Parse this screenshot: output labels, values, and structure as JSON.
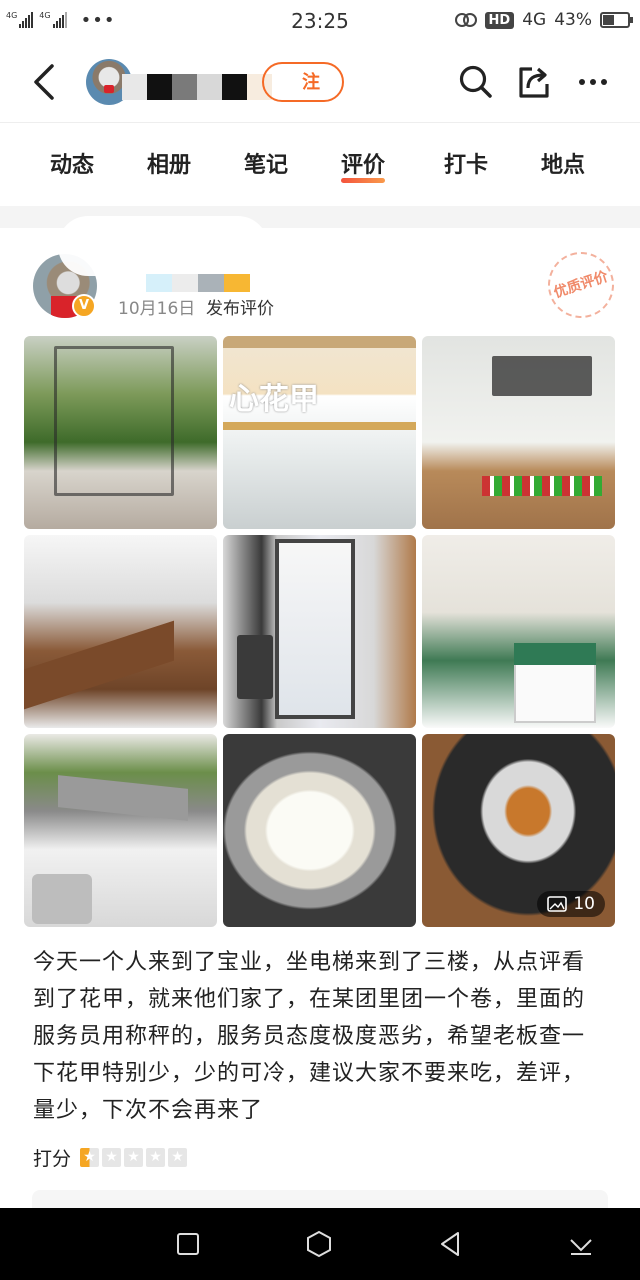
{
  "status_bar": {
    "net_left": "4G",
    "net_right": "4G",
    "time": "23:25",
    "hd": "HD",
    "network": "4G",
    "battery": "43%"
  },
  "header": {
    "follow_label": "注"
  },
  "tabs": [
    {
      "label": "动态",
      "active": false
    },
    {
      "label": "相册",
      "active": false
    },
    {
      "label": "笔记",
      "active": false
    },
    {
      "label": "评价",
      "active": true
    },
    {
      "label": "打卡",
      "active": false
    },
    {
      "label": "地点",
      "active": false
    }
  ],
  "review": {
    "date": "10月16日",
    "action": "发布评价",
    "quality_stamp": "优质评价",
    "photo_count": "10",
    "sign_text": "心花甲",
    "content": "今天一个人来到了宝业，坐电梯来到了三楼，从点评看到了花甲，就来他们家了，在某团里团一个卷，里面的服务员用称秤的，服务员态度极度恶劣，希望老板查一下花甲特别少，少的可冷，建议大家不要来吃，差评，量少，下次不会再来了",
    "score_label": "打分",
    "rating": 0.5,
    "rating_max": 5
  },
  "colors": {
    "accent": "#f56a26",
    "tab_underline": "#f4533d",
    "star": "#f5a623"
  }
}
